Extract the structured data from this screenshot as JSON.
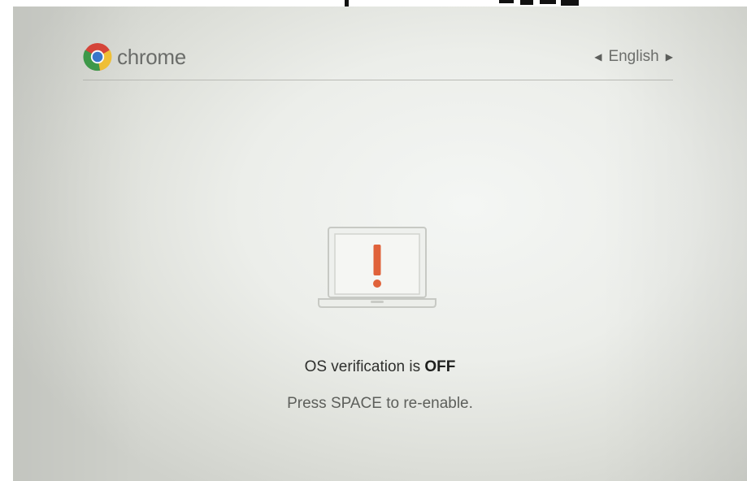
{
  "header": {
    "brand": "chrome",
    "language": "English",
    "prev_language_arrow": "◀",
    "next_language_arrow": "▶"
  },
  "icons": {
    "brand_icon": "chrome-logo-icon",
    "prev": "chevron-left-icon",
    "next": "chevron-right-icon",
    "illustration": "laptop-warning-icon"
  },
  "message": {
    "title_prefix": "OS verification is ",
    "title_status": "OFF",
    "instruction": "Press SPACE to re-enable."
  },
  "colors": {
    "warning_accent": "#e0623a",
    "text_dark": "#2e2f2d",
    "text_muted": "#5d5f5b"
  }
}
